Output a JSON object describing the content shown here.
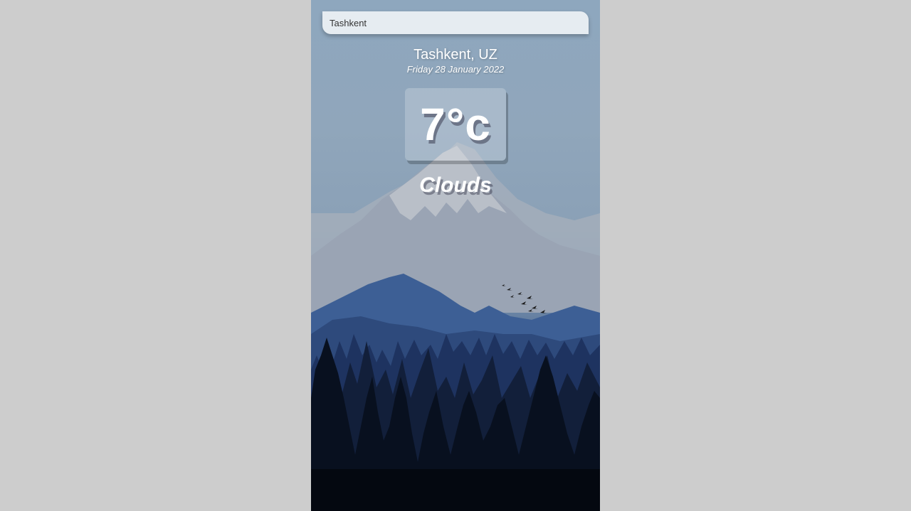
{
  "search": {
    "value": "Tashkent",
    "placeholder": "Search..."
  },
  "location": {
    "city_country": "Tashkent, UZ",
    "date": "Friday 28 January 2022"
  },
  "weather": {
    "temperature": "7°c",
    "condition": "Clouds"
  },
  "background": {
    "scene": "mountains-forest-birds",
    "colors": {
      "sky_top": "#8ea7be",
      "mountain_far": "#a9b8c6",
      "mountain_mid": "#3d5f95",
      "forest_dark": "#0b1424"
    }
  }
}
